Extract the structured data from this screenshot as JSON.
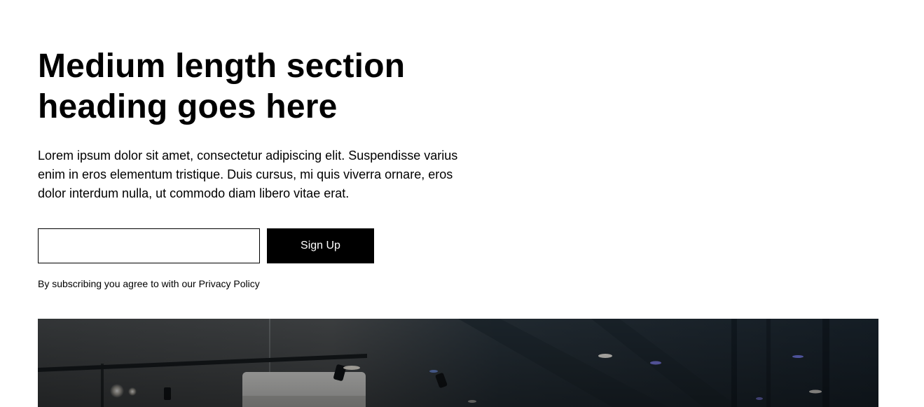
{
  "section": {
    "heading": "Medium length section heading goes here",
    "body": "Lorem ipsum dolor sit amet, consectetur adipiscing elit. Suspendisse varius enim in eros elementum tristique. Duis cursus, mi quis viverra ornare, eros dolor interdum nulla, ut commodo diam libero vitae erat."
  },
  "form": {
    "email_value": "",
    "email_placeholder": "",
    "submit_label": "Sign Up"
  },
  "legal": {
    "prefix": "By subscribing you agree to with our ",
    "link_label": "Privacy Policy"
  },
  "image": {
    "alt": "Dark interior of an office with ceiling lights and an air conditioner"
  }
}
